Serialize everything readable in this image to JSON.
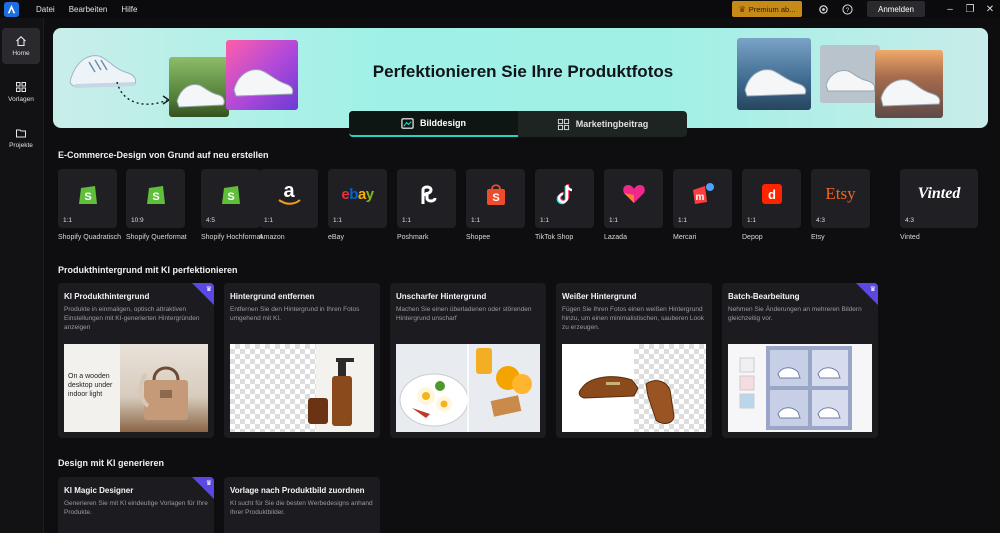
{
  "menu": {
    "items": [
      "Datei",
      "Bearbeiten",
      "Hilfe"
    ]
  },
  "titlebar": {
    "premium_label": "Premium ab...",
    "login_label": "Anmelden"
  },
  "sidebar": {
    "items": [
      {
        "label": "Home"
      },
      {
        "label": "Vorlagen"
      },
      {
        "label": "Projekte"
      }
    ]
  },
  "banner": {
    "title": "Perfektionieren Sie Ihre Produktfotos"
  },
  "tabs": [
    {
      "label": "Bilddesign"
    },
    {
      "label": "Marketingbeitrag"
    }
  ],
  "ecommerce": {
    "title": "E-Commerce-Design von Grund auf neu erstellen",
    "platforms": [
      {
        "name": "Shopify Quadratisch",
        "ratio": "1:1"
      },
      {
        "name": "Shopify Querformat",
        "ratio": "10:9"
      },
      {
        "name": "Shopify Hochformat",
        "ratio": "4:5"
      },
      {
        "name": "Amazon",
        "ratio": "1:1"
      },
      {
        "name": "eBay",
        "ratio": "1:1"
      },
      {
        "name": "Poshmark",
        "ratio": "1:1"
      },
      {
        "name": "Shopee",
        "ratio": "1:1"
      },
      {
        "name": "TikTok Shop",
        "ratio": "1:1"
      },
      {
        "name": "Lazada",
        "ratio": "1:1"
      },
      {
        "name": "Mercari",
        "ratio": "1:1"
      },
      {
        "name": "Depop",
        "ratio": "1:1"
      },
      {
        "name": "Etsy",
        "ratio": "4:3"
      },
      {
        "name": "Vinted",
        "ratio": "4:3"
      }
    ],
    "logos": {
      "ebay": "ebay",
      "etsy": "Etsy",
      "vinted": "Vinted"
    }
  },
  "background_section": {
    "title": "Produkthintergrund mit KI perfektionieren",
    "cards": [
      {
        "title": "KI Produkthintergrund",
        "desc": "Produkte in einmaligen, optisch attraktiven Einstellungen mit KI-generierten Hintergründen anzeigen",
        "image_text": "On a wooden desktop under indoor light"
      },
      {
        "title": "Hintergrund entfernen",
        "desc": "Entfernen Sie den Hintergrund in Ihren Fotos umgehend mit KI."
      },
      {
        "title": "Unscharfer Hintergrund",
        "desc": "Machen Sie einen überladenen oder störenden Hintergrund unscharf"
      },
      {
        "title": "Weißer Hintergrund",
        "desc": "Fügen Sie Ihren Fotos einen weißen Hintergrund hinzu, um einen minimalistischen, sauberen Look zu erzeugen."
      },
      {
        "title": "Batch-Bearbeitung",
        "desc": "Nehmen Sie Änderungen an mehreren Bildern gleichzeitig vor."
      }
    ]
  },
  "generate_section": {
    "title": "Design mit KI generieren",
    "cards": [
      {
        "title": "KI Magic Designer",
        "desc": "Generieren Sie mit KI eindeutige Vorlagen für Ihre Produkte."
      },
      {
        "title": "Vorlage nach Produktbild zuordnen",
        "desc": "KI sucht für Sie die besten Werbedesigns anhand Ihrer Produktbilder."
      }
    ]
  },
  "colors": {
    "accent": "#27d3c0",
    "premium": "#c58b16",
    "badge": "#5b48e0"
  }
}
